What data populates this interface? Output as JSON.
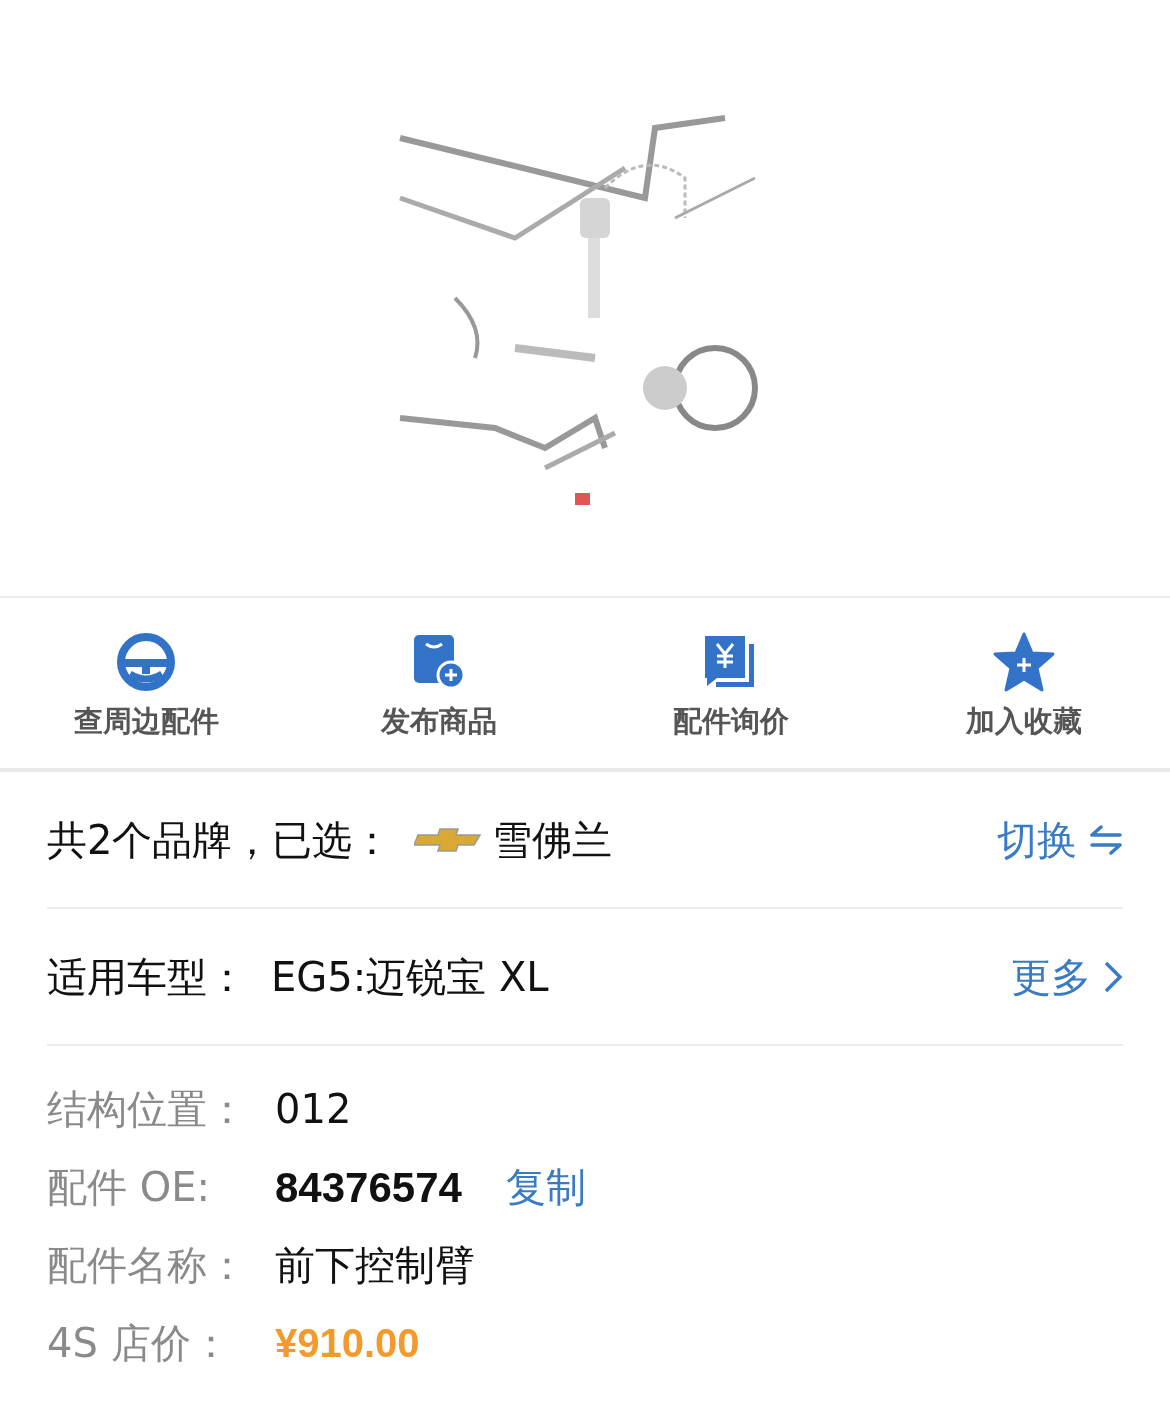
{
  "diagram": {
    "kind": "picture"
  },
  "actions": [
    {
      "label": "查周边配件",
      "kind": "wheel"
    },
    {
      "label": "发布商品",
      "kind": "bag"
    },
    {
      "label": "配件询价",
      "kind": "quote"
    },
    {
      "label": "加入收藏",
      "kind": "star"
    }
  ],
  "brand_row": {
    "text": "共2个品牌，已选：",
    "brand": "雪佛兰",
    "action": "切换"
  },
  "model_row": {
    "label": "适用车型：",
    "value": "EG5:迈锐宝 XL",
    "action": "更多"
  },
  "details": [
    {
      "label": "结构位置：",
      "value": "012",
      "kind": "plain"
    },
    {
      "label": "配件 OE:",
      "value": "84376574",
      "kind": "code",
      "action": "复制"
    },
    {
      "label": "配件名称：",
      "value": "前下控制臂",
      "kind": "plain"
    },
    {
      "label": "4S 店价：",
      "value": "¥910.00",
      "kind": "price"
    }
  ]
}
